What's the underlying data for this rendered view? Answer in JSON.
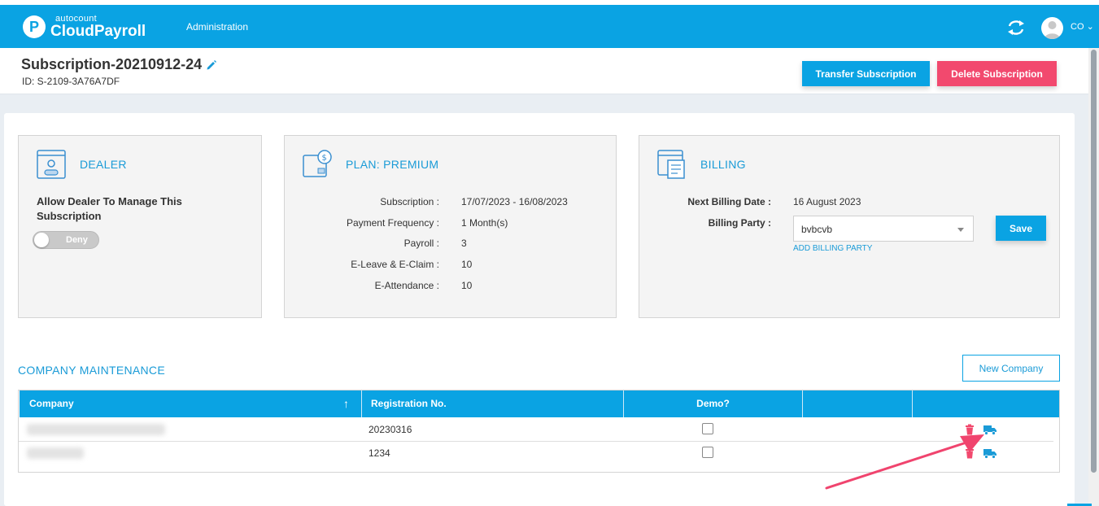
{
  "nav": {
    "logo_small": "autocount",
    "logo_big": "CloudPayroll",
    "logo_letter": "P",
    "admin_label": "Administration",
    "user_initials": "CO"
  },
  "header": {
    "title": "Subscription-20210912-24",
    "id_text": "ID: S-2109-3A76A7DF",
    "transfer_label": "Transfer Subscription",
    "delete_label": "Delete Subscription"
  },
  "dealer": {
    "title": "DEALER",
    "allow_label": "Allow Dealer To Manage This Subscription",
    "toggle_text": "Deny"
  },
  "plan": {
    "title": "PLAN: PREMIUM",
    "rows": [
      {
        "label": "Subscription :",
        "value": "17/07/2023 - 16/08/2023"
      },
      {
        "label": "Payment Frequency :",
        "value": "1 Month(s)"
      },
      {
        "label": "Payroll :",
        "value": "3"
      },
      {
        "label": "E-Leave & E-Claim :",
        "value": "10"
      },
      {
        "label": "E-Attendance :",
        "value": "10"
      }
    ]
  },
  "billing": {
    "title": "BILLING",
    "next_date_label": "Next Billing Date :",
    "next_date_value": "16 August 2023",
    "party_label": "Billing Party :",
    "party_value": "bvbcvb",
    "add_party_label": "ADD BILLING PARTY",
    "save_label": "Save"
  },
  "company": {
    "title": "COMPANY MAINTENANCE",
    "new_label": "New Company",
    "columns": [
      "Company",
      "Registration No.",
      "Demo?",
      "",
      ""
    ],
    "sort_glyph": "↑",
    "rows": [
      {
        "reg_no": "20230316"
      },
      {
        "reg_no": "1234"
      }
    ]
  },
  "colors": {
    "brand": "#0aa3e3",
    "danger": "#f2496e",
    "accent_text": "#1a9bd7"
  }
}
